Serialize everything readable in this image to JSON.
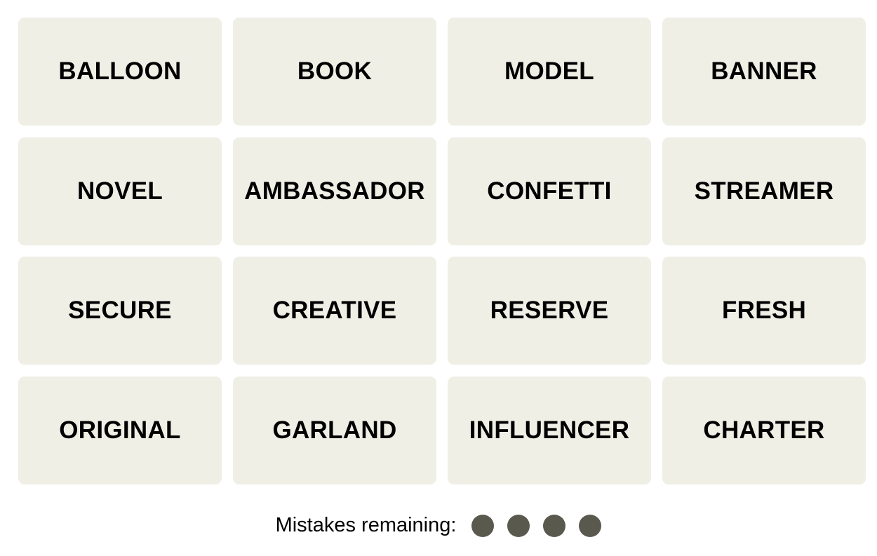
{
  "game": "Connections",
  "tiles": [
    "BALLOON",
    "BOOK",
    "MODEL",
    "BANNER",
    "NOVEL",
    "AMBASSADOR",
    "CONFETTI",
    "STREAMER",
    "SECURE",
    "CREATIVE",
    "RESERVE",
    "FRESH",
    "ORIGINAL",
    "GARLAND",
    "INFLUENCER",
    "CHARTER"
  ],
  "mistakes": {
    "label": "Mistakes remaining:",
    "remaining": 4,
    "dot_color": "#5a594e"
  },
  "colors": {
    "tile_background": "#efefe6",
    "tile_text": "#000000"
  }
}
